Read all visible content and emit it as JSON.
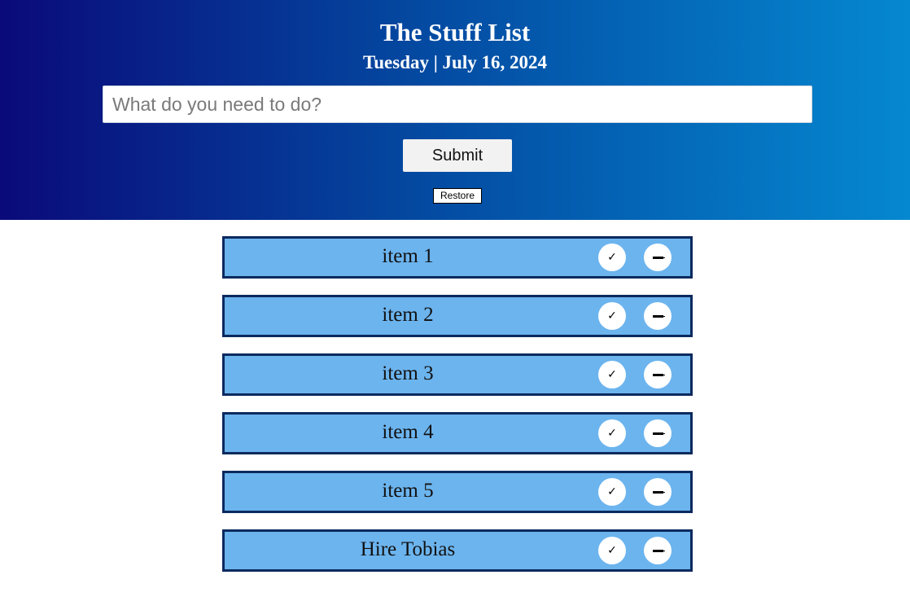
{
  "header": {
    "title": "The Stuff List",
    "date": "Tuesday | July 16, 2024",
    "input_placeholder": "What do you need to do?",
    "input_value": "",
    "submit_label": "Submit",
    "restore_label": "Restore"
  },
  "items": [
    {
      "label": "item 1",
      "check_icon": "✓"
    },
    {
      "label": "item 2",
      "check_icon": "✓"
    },
    {
      "label": "item 3",
      "check_icon": "✓"
    },
    {
      "label": "item 4",
      "check_icon": "✓"
    },
    {
      "label": "item 5",
      "check_icon": "✓"
    },
    {
      "label": "Hire Tobias",
      "check_icon": "✓"
    }
  ],
  "colors": {
    "header_gradient_start": "#0a0a7a",
    "header_gradient_end": "#0588d0",
    "item_background": "#6cb4ee",
    "item_border": "#0b2a5e"
  },
  "icons": {
    "check": "check-icon",
    "remove": "remove-icon"
  }
}
